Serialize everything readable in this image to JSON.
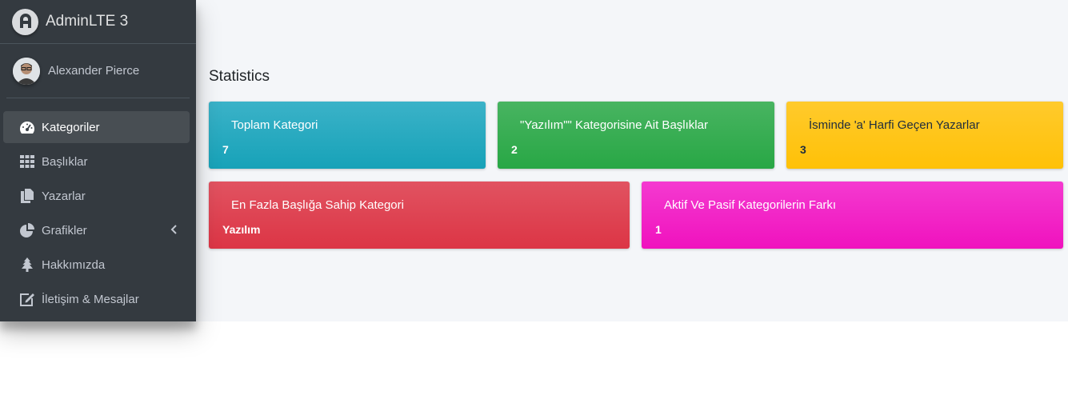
{
  "brand": {
    "name": "AdminLTE 3",
    "logo_icon": "adminlte-logo-icon"
  },
  "user": {
    "name": "Alexander Pierce"
  },
  "sidebar": {
    "items": [
      {
        "label": "Kategoriler",
        "icon": "tachometer-icon",
        "active": true
      },
      {
        "label": "Başlıklar",
        "icon": "grid-icon"
      },
      {
        "label": "Yazarlar",
        "icon": "copy-icon"
      },
      {
        "label": "Grafikler",
        "icon": "pie-chart-icon",
        "has_submenu": true
      },
      {
        "label": "Hakkımızda",
        "icon": "tree-icon"
      },
      {
        "label": "İletişim & Mesajlar",
        "icon": "edit-icon"
      }
    ]
  },
  "main": {
    "title": "Statistics",
    "boxes": [
      {
        "label": "Toplam Kategori",
        "value": "7",
        "color": "#17a2b8"
      },
      {
        "label": "\"Yazılım\"\" Kategorisine Ait Başlıklar",
        "value": "2",
        "color": "#28a745"
      },
      {
        "label": "İsminde 'a' Harfi Geçen Yazarlar",
        "value": "3",
        "color": "#ffc107"
      },
      {
        "label": "En Fazla Başlığa Sahip Kategori",
        "value": "Yazılım",
        "color": "#dc3545"
      },
      {
        "label": "Aktif Ve Pasif Kategorilerin Farkı",
        "value": "1",
        "color": "#f012be"
      }
    ]
  }
}
